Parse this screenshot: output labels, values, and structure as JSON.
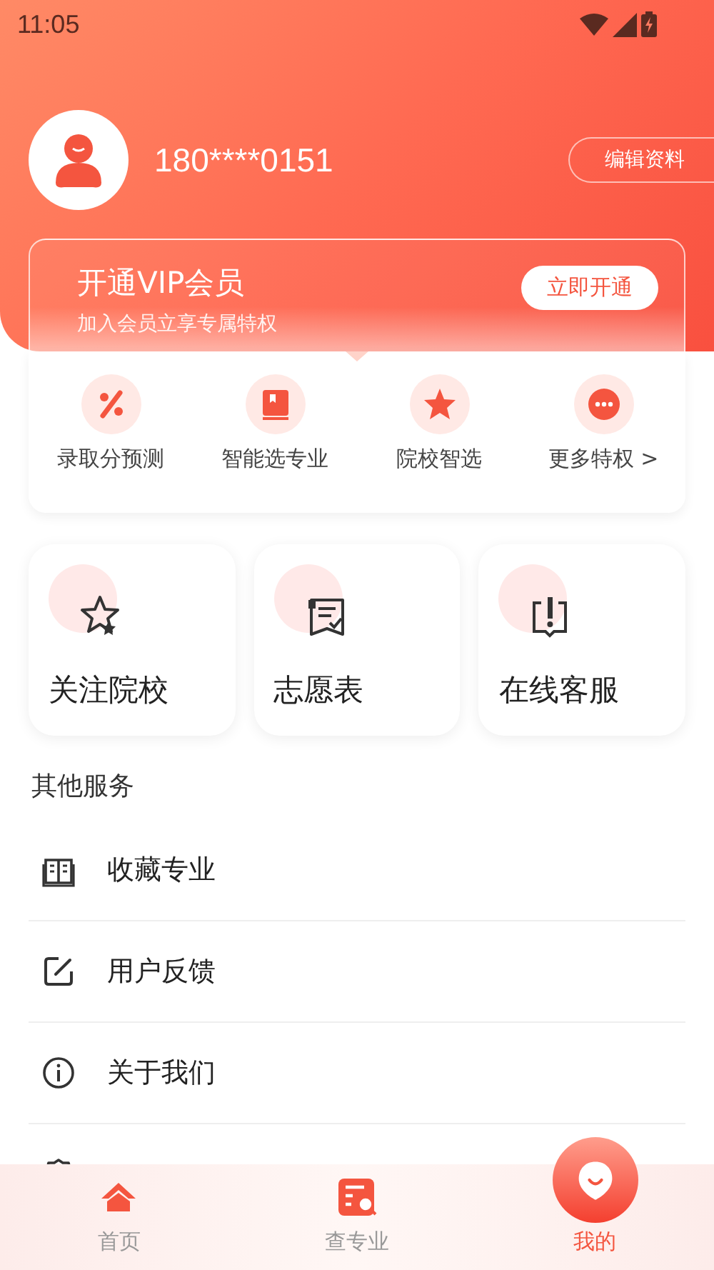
{
  "status_bar": {
    "time": "11:05"
  },
  "profile": {
    "phone": "180****0151",
    "edit_button": "编辑资料"
  },
  "vip": {
    "title": "开通VIP会员",
    "subtitle": "加入会员立享专属特权",
    "button": "立即开通"
  },
  "features": [
    {
      "label": "录取分预测"
    },
    {
      "label": "智能选专业"
    },
    {
      "label": "院校智选"
    },
    {
      "label": "更多特权 >"
    }
  ],
  "cards": [
    {
      "label": "关注院校"
    },
    {
      "label": "志愿表"
    },
    {
      "label": "在线客服"
    }
  ],
  "section_title": "其他服务",
  "services": [
    {
      "label": "收藏专业"
    },
    {
      "label": "用户反馈"
    },
    {
      "label": "关于我们"
    }
  ],
  "tabs": [
    {
      "label": "首页",
      "selected": false
    },
    {
      "label": "查专业",
      "selected": false
    },
    {
      "label": "我的",
      "selected": true
    }
  ]
}
